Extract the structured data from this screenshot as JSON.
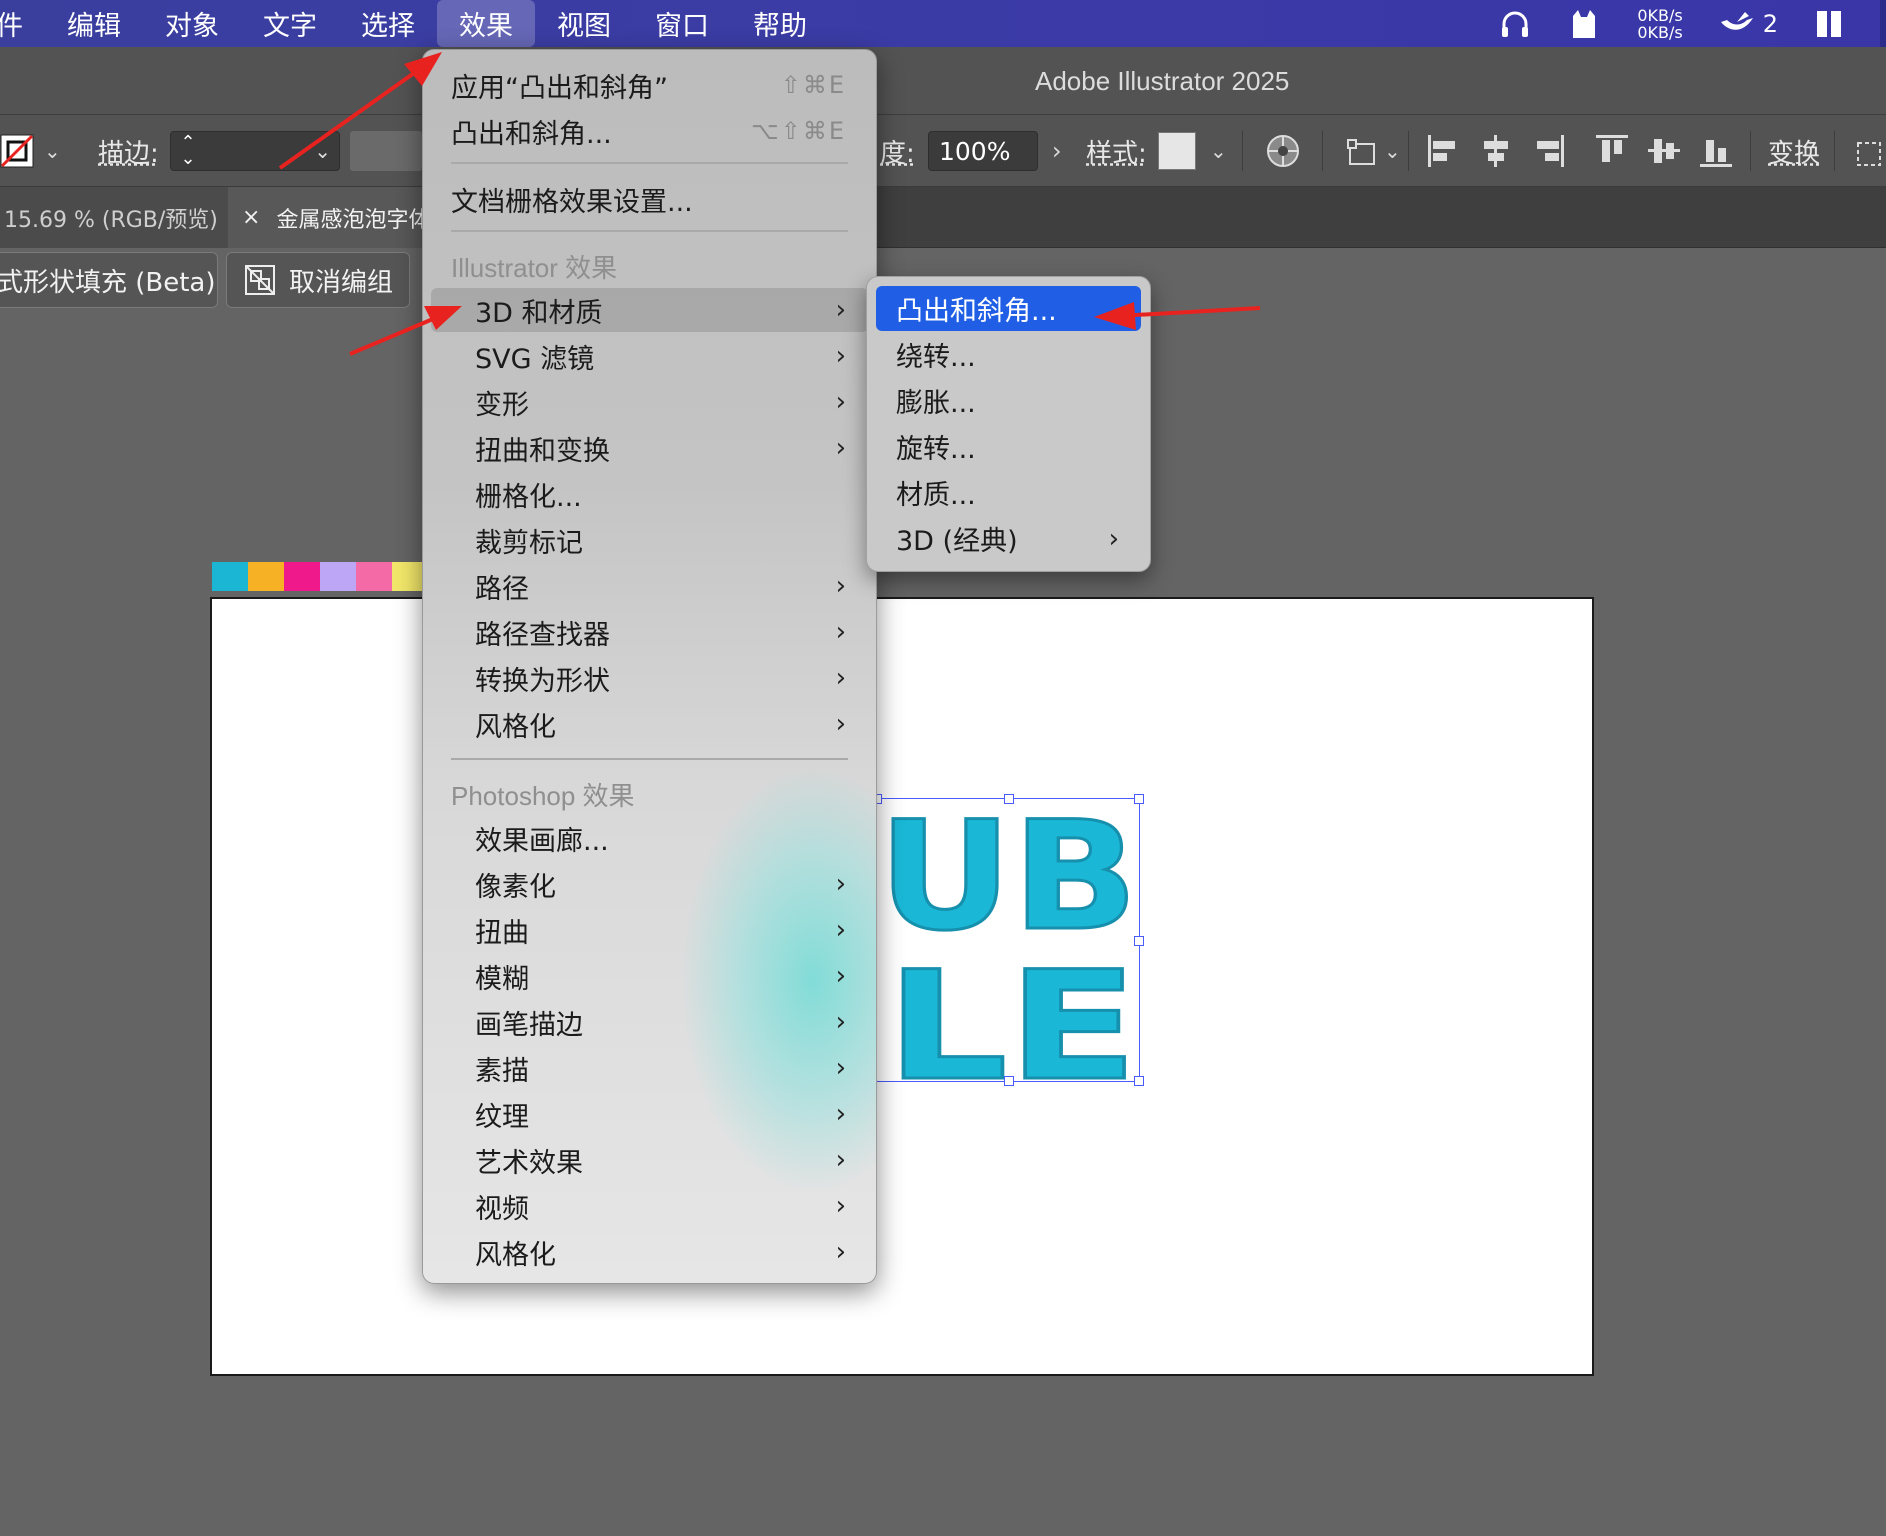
{
  "menubar": {
    "items": [
      "件",
      "编辑",
      "对象",
      "文字",
      "选择",
      "效果",
      "视图",
      "窗口",
      "帮助"
    ],
    "active_index": 5,
    "status": {
      "headphones_icon": "headphones-icon",
      "cat_icon": "cat-icon",
      "net_up": "0KB/s",
      "net_down": "0KB/s",
      "bird_count": "2",
      "grid_icon": "grid-icon"
    }
  },
  "app": {
    "title": "Adobe Illustrator 2025"
  },
  "controlbar": {
    "stroke_label": "描边:",
    "opacity_label": "度:",
    "opacity_value": "100%",
    "style_label": "样式:",
    "transform_label": "变换"
  },
  "tabs": {
    "tab1": "15.69 % (RGB/预览)",
    "tab2_close": "×",
    "tab2": "金属感泡泡字体"
  },
  "taskbar": {
    "btn1": "式形状填充 (Beta)",
    "btn2": "取消编组"
  },
  "canvas": {
    "swatches": [
      "#1ab6d3",
      "#f6b125",
      "#f0198c",
      "#bda6f5",
      "#f36aa7",
      "#f2e76a"
    ],
    "word_line1": "UB",
    "word_line2": "LE",
    "text_color": "#1ab8d6"
  },
  "effect_menu": {
    "apply_last": "应用“凸出和斜角”",
    "apply_last_shortcut": "⇧⌘E",
    "last_effect": "凸出和斜角...",
    "last_effect_shortcut": "⌥⇧⌘E",
    "doc_raster": "文档栅格效果设置...",
    "illustrator_header": "Illustrator 效果",
    "illustrator_items": [
      "3D 和材质",
      "SVG 滤镜",
      "变形",
      "扭曲和变换",
      "栅格化...",
      "裁剪标记",
      "路径",
      "路径查找器",
      "转换为形状",
      "风格化"
    ],
    "photoshop_header": "Photoshop 效果",
    "photoshop_items": [
      "效果画廊...",
      "像素化",
      "扭曲",
      "模糊",
      "画笔描边",
      "素描",
      "纹理",
      "艺术效果",
      "视频",
      "风格化"
    ]
  },
  "submenu_3d": {
    "items": [
      "凸出和斜角...",
      "绕转...",
      "膨胀...",
      "旋转...",
      "材质...",
      "3D (经典)"
    ],
    "selected_index": 0,
    "selected_color": "#1f5ee5"
  },
  "annotation_color": "#e8231f"
}
